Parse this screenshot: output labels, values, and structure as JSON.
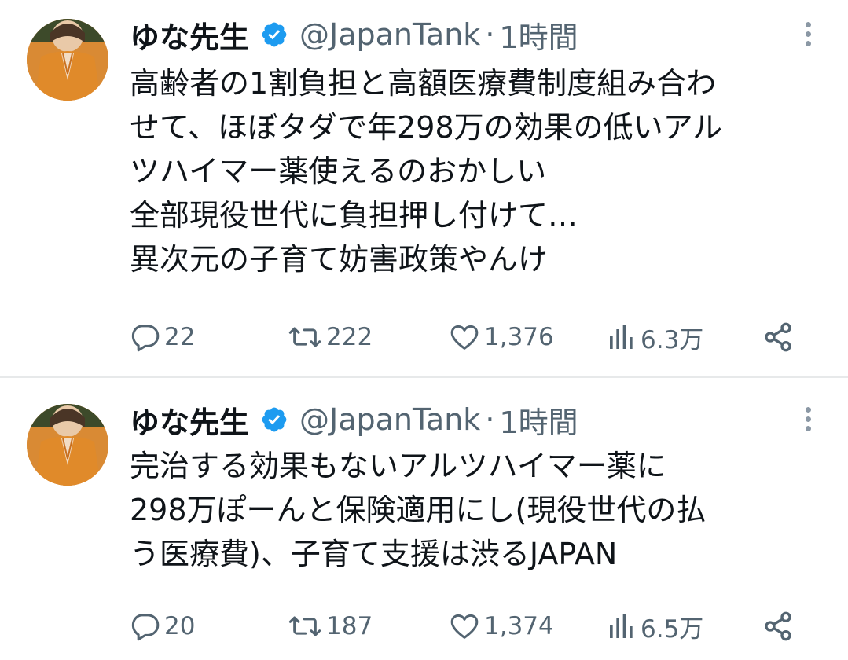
{
  "tweets": [
    {
      "display_name": "ゆな先生",
      "handle": "@JapanTank",
      "separator": "·",
      "time": "1時間",
      "avatar_icon": "avatar-photo",
      "verified_icon": "verified-badge-icon",
      "text_lines": [
        "高齢者の1割負担と高額医療費制度組み合わ",
        "せて、ほぼタダで年298万の効果の低いアル",
        "ツハイマー薬使えるのおかしい",
        "全部現役世代に負担押し付けて…",
        "異次元の子育て妨害政策やんけ"
      ],
      "stats": {
        "replies": "22",
        "retweets": "222",
        "likes": "1,376",
        "views": "6.3万"
      }
    },
    {
      "display_name": "ゆな先生",
      "handle": "@JapanTank",
      "separator": "·",
      "time": "1時間",
      "avatar_icon": "avatar-photo",
      "verified_icon": "verified-badge-icon",
      "text_lines": [
        "完治する効果もないアルツハイマー薬に",
        "298万ぽーんと保険適用にし(現役世代の払",
        "う医療費)、子育て支援は渋るJAPAN"
      ],
      "stats": {
        "replies": "20",
        "retweets": "187",
        "likes": "1,374",
        "views": "6.5万"
      }
    }
  ],
  "colors": {
    "verified": "#1d9bf0",
    "muted_text": "#536471",
    "primary_text": "#0f1419",
    "divider": "#e7e9ea"
  },
  "icons": [
    "reply-icon",
    "retweet-icon",
    "like-icon",
    "views-icon",
    "share-icon",
    "more-icon"
  ]
}
